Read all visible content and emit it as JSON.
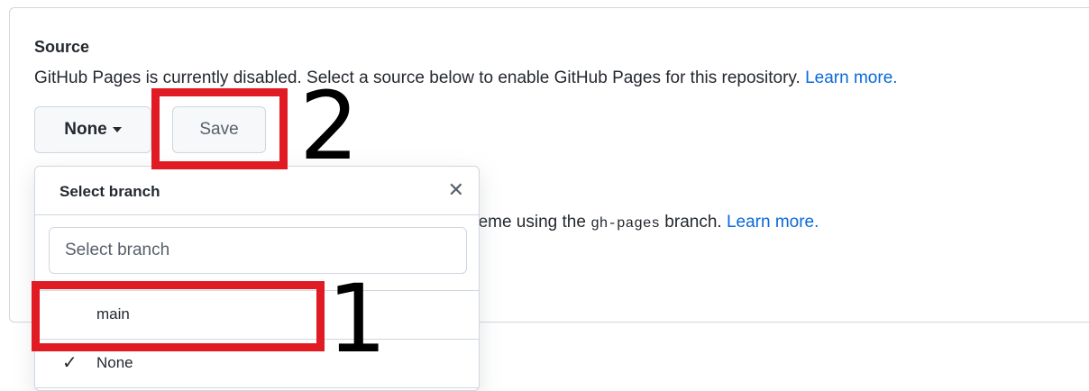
{
  "source": {
    "heading": "Source",
    "description": "GitHub Pages is currently disabled. Select a source below to enable GitHub Pages for this repository.",
    "learn_more": "Learn more.",
    "branch_button_label": "None",
    "save_label": "Save"
  },
  "theme": {
    "text_before": "heme using the ",
    "code": "gh-pages",
    "text_after": " branch.",
    "learn_more": "Learn more."
  },
  "branch_menu": {
    "title": "Select branch",
    "close_icon": "close-icon",
    "filter_placeholder": "Select branch",
    "items": [
      {
        "label": "main",
        "selected": false
      },
      {
        "label": "None",
        "selected": true
      }
    ]
  },
  "annotations": {
    "step_1": "1",
    "step_2": "2",
    "highlight_color": "#e01b24"
  },
  "colors": {
    "link": "#0969da",
    "border": "#d0d7de",
    "button_bg": "#f6f8fa"
  }
}
